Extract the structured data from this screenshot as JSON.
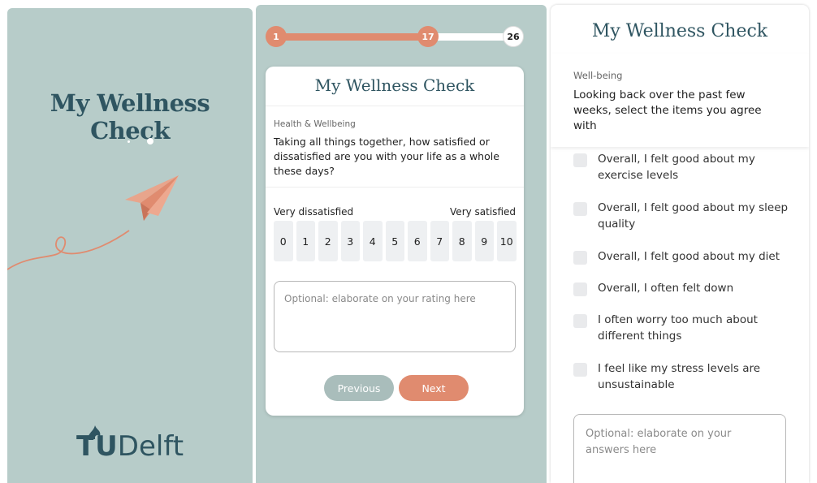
{
  "splash": {
    "app_title": "My Wellness Check",
    "logo_prefix": "TU",
    "logo_suffix": "Delft",
    "colors": {
      "background": "#b7ccc9",
      "title": "#2f5561",
      "accent": "#e08b6f"
    }
  },
  "rating_screen": {
    "progress": {
      "start_label": "1",
      "current_label": "17",
      "total_label": "26",
      "current": 17,
      "total": 26
    },
    "app_title": "My Wellness Check",
    "category": "Health & Wellbeing",
    "question": "Taking all things together, how satisfied or dissatisfied are you with your life as a whole these days?",
    "scale_low_label": "Very dissatisfied",
    "scale_high_label": "Very satisfied",
    "scale_values": [
      "0",
      "1",
      "2",
      "3",
      "4",
      "5",
      "6",
      "7",
      "8",
      "9",
      "10"
    ],
    "comment_placeholder": "Optional: elaborate on your rating here",
    "previous_label": "Previous",
    "next_label": "Next"
  },
  "checklist_screen": {
    "app_title": "My Wellness Check",
    "category": "Well-being",
    "prompt": "Looking back over the past few weeks, select the items you agree with",
    "items": [
      "Overall, I felt good about my exercise levels",
      "Overall, I felt good about my sleep quality",
      "Overall, I felt good about my diet",
      "Overall, I often felt down",
      "I often worry too much about different things",
      "I feel like my stress levels are unsustainable"
    ],
    "comment_placeholder": "Optional: elaborate on your answers here"
  }
}
